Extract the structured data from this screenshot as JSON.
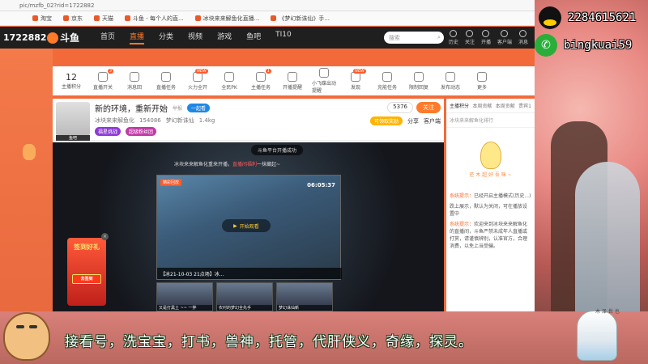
{
  "browser": {
    "url": "pic/mzfb_02?rid=1722882",
    "bookmarks": [
      "淘宝",
      "京东",
      "天猫",
      "斗鱼 - 每个人的直...",
      "冰块来来解鱼化直播...",
      "《梦幻新诛仙》手..."
    ]
  },
  "site": {
    "room_id": "1722882",
    "logo": "斗鱼",
    "nav": [
      "首页",
      "直播",
      "分类",
      "视频",
      "游戏",
      "鱼吧",
      "TI10"
    ],
    "active_nav": "直播",
    "search_placeholder": "搜索",
    "icons": [
      "历史",
      "关注",
      "开播",
      "客户端",
      "消息"
    ]
  },
  "toolbar": {
    "fans_count": "12",
    "fans_label": "主播积分",
    "items": [
      {
        "label": "直播开关",
        "badge": "3"
      },
      {
        "label": "消息回",
        "badge": ""
      },
      {
        "label": "直播任务",
        "badge": ""
      },
      {
        "label": "火力全开",
        "badge": "NEW"
      },
      {
        "label": "全民PK",
        "badge": ""
      },
      {
        "label": "主播任务",
        "badge": "1"
      },
      {
        "label": "开播提醒",
        "badge": ""
      },
      {
        "label": "小飞碟出动提醒",
        "badge": ""
      },
      {
        "label": "发现",
        "badge": "NEW"
      },
      {
        "label": "充能任务",
        "badge": ""
      },
      {
        "label": "限制回复",
        "badge": ""
      },
      {
        "label": "发布动态",
        "badge": ""
      },
      {
        "label": "更多",
        "badge": ""
      }
    ]
  },
  "room": {
    "title": "新的环境，重新开始",
    "report": "举报",
    "category_tag": "一起看",
    "meta1": "冰块来来解鱼化",
    "heat": "154086",
    "game": "梦幻新诛仙",
    "rank": "1.4kg",
    "follow_count": "5376",
    "follow_label": "关注",
    "share": "分享",
    "client": "客户端",
    "avatar_label": "鱼吧",
    "badge_a": "福星挑战",
    "badge_b": "超级粉丝团",
    "mission": "可领取奖励"
  },
  "player": {
    "notice": "斗鱼平台开播成功",
    "scroll": "冰块来来解鱼化重来开播，",
    "scroll_red": "直播间福利",
    "scroll_end": "一抹藏起~",
    "video_tag": "精彩回放",
    "video_time": "06:05:37",
    "play_label": "开始观看",
    "video_caption": "【冰21-10-03 21点场】冰...",
    "thumbs": [
      "又是打黑土 ~~ 一拌",
      "农村的梦幻全先手",
      "梦幻诛仙新"
    ]
  },
  "promo": {
    "title": "签到好礼",
    "button": "去签到"
  },
  "chat": {
    "tabs": [
      "主播积分",
      "本周贡献",
      "本周贡献",
      "贵宾1"
    ],
    "sub": "冰块来来解鱼化排行",
    "mascot_text": "还 木 超 好 吾 咪 ~",
    "messages": [
      {
        "sys": "系统提示：",
        "text": "已经开启主播模式(历史...)"
      },
      {
        "sys": "",
        "text": "跌上展示，默认为关闭，可在播放设置中"
      },
      {
        "sys": "系统提示：",
        "text": "欢迎来到冰块来来解鱼化的直播间，斗鱼严禁未成年人直播或打赏，请谨慎辨别，认准官方，合理消费，以免上当受骗。"
      }
    ]
  },
  "overlay": {
    "qq": "2284615621",
    "wechat": "bingkuai59",
    "subtitle": "接看号，洗宝宝，打书，兽神，托管，代肝侠义，奇缘，探灵。",
    "chibi_label": "木 泽 世 也"
  }
}
